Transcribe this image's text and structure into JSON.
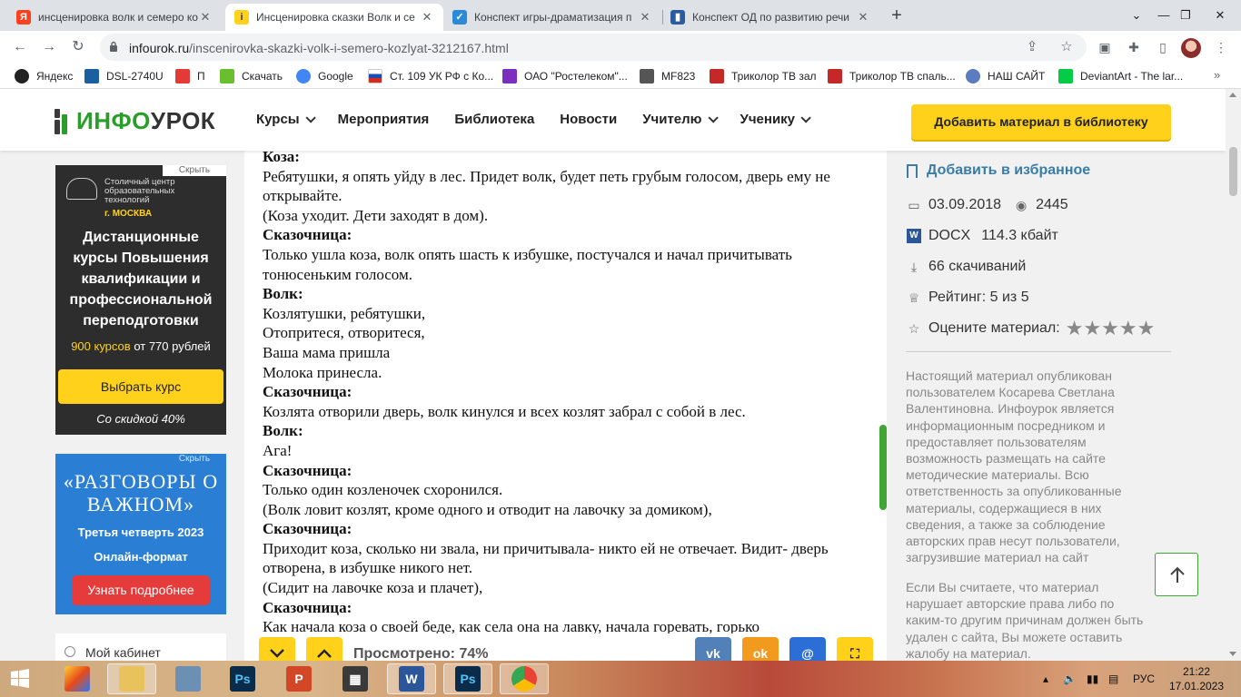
{
  "browser": {
    "tabs": [
      {
        "title": "инсценировка волк и семеро ко",
        "favicon": "yandex-icon",
        "color": "#fc3f1d",
        "glyph": "Я"
      },
      {
        "title": "Инсценировка сказки Волк и се",
        "favicon": "infourok-icon",
        "color": "#ffd11a",
        "glyph": "i"
      },
      {
        "title": "Конспект игры-драматизация п",
        "favicon": "check-icon",
        "color": "#2b8ad8",
        "glyph": "✓"
      },
      {
        "title": "Конспект ОД по развитию речи",
        "favicon": "book-icon",
        "color": "#2c5aa0",
        "glyph": "▮"
      }
    ],
    "new_tab": "+",
    "url_host": "infourok.ru",
    "url_path": "/inscenirovka-skazki-volk-i-semero-kozlyat-3212167.html",
    "bookmarks": [
      {
        "label": "Яндекс",
        "icon": "yandex-bookmark-icon",
        "color": "#222"
      },
      {
        "label": "DSL-2740U",
        "icon": "dlink-icon",
        "color": "#1a5fa0"
      },
      {
        "label": "П",
        "icon": "mail-icon",
        "color": "#e53935"
      },
      {
        "label": "Скачать",
        "icon": "download-green-icon",
        "color": "#6abf2e"
      },
      {
        "label": "Google",
        "icon": "google-icon",
        "color": "#4285f4"
      },
      {
        "label": "Ст. 109 УК РФ с Ко...",
        "icon": "ru-flag-icon",
        "color": "#d52b1e"
      },
      {
        "label": "ОАО \"Ростелеком\"...",
        "icon": "rostelecom-icon",
        "color": "#7b2fbf"
      },
      {
        "label": "MF823",
        "icon": "modem-icon",
        "color": "#555"
      },
      {
        "label": "Триколор ТВ зал",
        "icon": "tricolor-icon",
        "color": "#c62828"
      },
      {
        "label": "Триколор ТВ спаль...",
        "icon": "tricolor-icon",
        "color": "#c62828"
      },
      {
        "label": "НАШ САЙТ",
        "icon": "globe-icon",
        "color": "#5c7cbf"
      },
      {
        "label": "DeviantArt - The lar...",
        "icon": "deviantart-icon",
        "color": "#05cc47"
      }
    ],
    "bookmarks_more": "»"
  },
  "site": {
    "logo_green": "ИНФО",
    "logo_dark": "УРОК",
    "nav": [
      {
        "label": "Курсы",
        "dropdown": true
      },
      {
        "label": "Мероприятия",
        "dropdown": false
      },
      {
        "label": "Библиотека",
        "dropdown": false
      },
      {
        "label": "Новости",
        "dropdown": false
      },
      {
        "label": "Учителю",
        "dropdown": true
      },
      {
        "label": "Ученику",
        "dropdown": true
      }
    ],
    "add_button": "Добавить материал в библиотеку"
  },
  "ads": {
    "ad1": {
      "hide": "Скрыть",
      "org": "Столичный центр образовательных технологий",
      "city": "г. МОСКВА",
      "headline": "Дистанционные курсы Повышения квалификации и профессиональной переподготовки",
      "price_highlight": "900 курсов",
      "price_rest": " от 770 рублей",
      "button": "Выбрать курс",
      "discount": "Со скидкой 40%"
    },
    "ad2": {
      "hide": "Скрыть",
      "title": "«РАЗГОВОРЫ О ВАЖНОМ»",
      "subtitle": "Третья четверть 2023",
      "format": "Онлайн-формат",
      "button": "Узнать подробнее"
    },
    "cabinet": "Мой кабинет"
  },
  "document": {
    "lines": [
      {
        "text": "Коза:",
        "bold": true
      },
      {
        "text": "Ребятушки, я опять уйду в лес. Придет волк, будет петь грубым голосом, дверь ему не открывайте.",
        "bold": false
      },
      {
        "text": "(Коза уходит. Дети заходят в дом).",
        "bold": false
      },
      {
        "text": "Сказочница:",
        "bold": true
      },
      {
        "text": "Только ушла коза, волк опять шасть к избушке, постучался и начал причитывать тонюсеньким голосом.",
        "bold": false
      },
      {
        "text": "Волк:",
        "bold": true
      },
      {
        "text": "Козлятушки, ребятушки,",
        "bold": false
      },
      {
        "text": "Отопритеся, отворитеся,",
        "bold": false
      },
      {
        "text": "Ваша мама пришла",
        "bold": false
      },
      {
        "text": "Молока принесла.",
        "bold": false
      },
      {
        "text": "Сказочница:",
        "bold": true
      },
      {
        "text": "Козлята отворили дверь, волк кинулся и всех козлят забрал с собой в лес.",
        "bold": false
      },
      {
        "text": "Волк:",
        "bold": true
      },
      {
        "text": "Ага!",
        "bold": false
      },
      {
        "text": "Сказочница:",
        "bold": true
      },
      {
        "text": "Только один козленочек схоронился.",
        "bold": false
      },
      {
        "text": "(Волк ловит козлят, кроме одного и отводит на лавочку за домиком),",
        "bold": false
      },
      {
        "text": "Сказочница:",
        "bold": true
      },
      {
        "text": "Приходит коза, сколько ни звала, ни причитывала- никто ей не отвечает. Видит- дверь отворена, в избушке никого нет.",
        "bold": false
      },
      {
        "text": "(Сидит на лавочке коза и плачет),",
        "bold": false
      },
      {
        "text": "Сказочница:",
        "bold": true
      },
      {
        "text": "Как начала коза о своей беде, как села она на лавку, начала горевать, горько",
        "bold": false
      }
    ],
    "viewed": "Просмотрено: 74%",
    "viewed_fraction": 0.74
  },
  "sidebar": {
    "favorite": "Добавить в избранное",
    "date": "03.09.2018",
    "views": "2445",
    "file_type": "DOCX",
    "file_size": "114.3 кбайт",
    "downloads": "66 скачиваний",
    "rating": "Рейтинг: 5 из 5",
    "rate_label": "Оцените материал:",
    "stars": 5,
    "notice": "Настоящий материал опубликован пользователем Косарева Светлана Валентиновна. Инфоурок является информационным посредником и предоставляет пользователям возможность размещать на сайте методические материалы. Всю ответственность за опубликованные материалы, содержащиеся в них сведения, а также за соблюдение авторских прав несут пользователи, загрузившие материал на сайт",
    "notice2": "Если Вы считаете, что материал нарушает авторские права либо по каким-то другим причинам должен быть удален с сайта, Вы можете оставить жалобу на материал."
  },
  "taskbar": {
    "lang": "РУС",
    "time": "21:22",
    "date": "17.01.2023"
  },
  "colors": {
    "accent_yellow": "#ffd11a",
    "brand_green": "#2a9d2a",
    "link_blue": "#3a7ca5"
  }
}
